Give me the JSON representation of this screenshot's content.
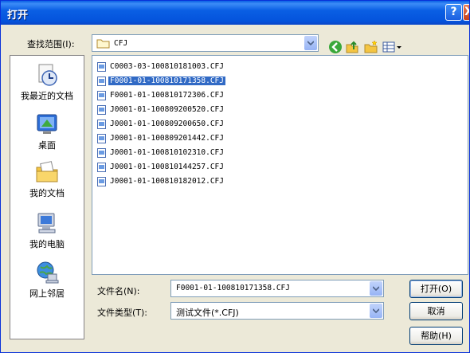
{
  "window": {
    "title": "打开",
    "help_glyph": "?",
    "close_glyph": "X"
  },
  "lookin": {
    "label": "查找范围(I):",
    "value": "CFJ"
  },
  "places": [
    {
      "label": "我最近的文档",
      "icon": "recent-documents-icon"
    },
    {
      "label": "桌面",
      "icon": "desktop-icon"
    },
    {
      "label": "我的文档",
      "icon": "my-documents-icon"
    },
    {
      "label": "我的电脑",
      "icon": "my-computer-icon"
    },
    {
      "label": "网上邻居",
      "icon": "network-places-icon"
    }
  ],
  "files": [
    {
      "name": "C0003-03-100810181003.CFJ",
      "selected": false
    },
    {
      "name": "F0001-01-100810171358.CFJ",
      "selected": true
    },
    {
      "name": "F0001-01-100810172306.CFJ",
      "selected": false
    },
    {
      "name": "J0001-01-100809200520.CFJ",
      "selected": false
    },
    {
      "name": "J0001-01-100809200650.CFJ",
      "selected": false
    },
    {
      "name": "J0001-01-100809201442.CFJ",
      "selected": false
    },
    {
      "name": "J0001-01-100810102310.CFJ",
      "selected": false
    },
    {
      "name": "J0001-01-100810144257.CFJ",
      "selected": false
    },
    {
      "name": "J0001-01-100810182012.CFJ",
      "selected": false
    }
  ],
  "filename": {
    "label": "文件名(N):",
    "value": "F0001-01-100810171358.CFJ"
  },
  "filetype": {
    "label": "文件类型(T):",
    "value": "测试文件(*.CFJ)"
  },
  "buttons": {
    "open": "打开(O)",
    "cancel": "取消",
    "help": "帮助(H)"
  },
  "colors": {
    "title_bar": "#0a5fe4",
    "selection": "#316ac5",
    "dialog_bg": "#ece9d8"
  }
}
